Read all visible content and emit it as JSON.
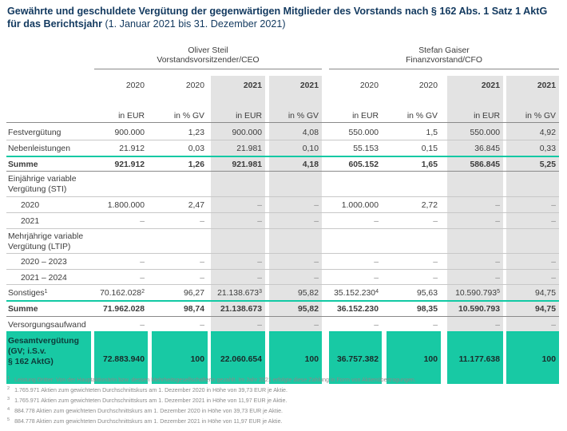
{
  "title": {
    "bold": "Gewährte und geschuldete Vergütung der gegenwärtigen Mitglieder des Vorstands nach § 162 Abs. 1 Satz 1 AktG für das Berichtsjahr",
    "light": "(1. Januar 2021 bis 31. Dezember 2021)"
  },
  "persons": [
    {
      "name": "Oliver Steil",
      "role": "Vorstandsvorsitzender/CEO"
    },
    {
      "name": "Stefan Gaiser",
      "role": "Finanzvorstand/CFO"
    }
  ],
  "years": [
    "2020",
    "2020",
    "2021",
    "2021",
    "2020",
    "2020",
    "2021",
    "2021"
  ],
  "units": [
    "in EUR",
    "in % GV",
    "in EUR",
    "in % GV",
    "in EUR",
    "in % GV",
    "in EUR",
    "in % GV"
  ],
  "rows": [
    {
      "label": "Festvergütung",
      "values": [
        "900.000",
        "1,23",
        "900.000",
        "4,08",
        "550.000",
        "1,5",
        "550.000",
        "4,92"
      ]
    },
    {
      "label": "Nebenleistungen",
      "values": [
        "21.912",
        "0,03",
        "21.981",
        "0,10",
        "55.153",
        "0,15",
        "36.845",
        "0,33"
      ]
    },
    {
      "label": "Summe",
      "values": [
        "921.912",
        "1,26",
        "921.981",
        "4,18",
        "605.152",
        "1,65",
        "586.845",
        "5,25"
      ]
    },
    {
      "label": "Einjährige variable",
      "label2": "Vergütung (STI)",
      "values": [
        "",
        "",
        "",
        "",
        "",
        "",
        "",
        ""
      ]
    },
    {
      "label": "2020",
      "values": [
        "1.800.000",
        "2,47",
        "–",
        "–",
        "1.000.000",
        "2,72",
        "–",
        "–"
      ]
    },
    {
      "label": "2021",
      "values": [
        "–",
        "–",
        "–",
        "–",
        "–",
        "–",
        "–",
        "–"
      ]
    },
    {
      "label": "Mehrjährige variable",
      "label2": "Vergütung (LTIP)",
      "values": [
        "",
        "",
        "",
        "",
        "",
        "",
        "",
        ""
      ]
    },
    {
      "label": "2020 – 2023",
      "values": [
        "–",
        "–",
        "–",
        "–",
        "–",
        "–",
        "–",
        "–"
      ]
    },
    {
      "label": "2021 – 2024",
      "values": [
        "–",
        "–",
        "–",
        "–",
        "–",
        "–",
        "–",
        "–"
      ]
    },
    {
      "label": "Sonstiges",
      "label_sup": "1",
      "values": [
        "70.162.028",
        "96,27",
        "21.138.673",
        "95,82",
        "35.152.230",
        "95,63",
        "10.590.793",
        "94,75"
      ],
      "sups": [
        "2",
        "",
        "3",
        "",
        "4",
        "",
        "5",
        ""
      ]
    },
    {
      "label": "Summe",
      "values": [
        "71.962.028",
        "98,74",
        "21.138.673",
        "95,82",
        "36.152.230",
        "98,35",
        "10.590.793",
        "94,75"
      ]
    },
    {
      "label": "Versorgungsaufwand",
      "values": [
        "–",
        "–",
        "–",
        "–",
        "–",
        "–",
        "–",
        "–"
      ]
    },
    {
      "label": "Gesamtvergütung",
      "label2": "(GV; i.S.v.",
      "label3": "§ 162 AktG)",
      "values": [
        "72.883.940",
        "100",
        "22.060.654",
        "100",
        "36.757.382",
        "100",
        "11.177.638",
        "100"
      ]
    }
  ],
  "footnotes": [
    {
      "n": "1",
      "text": "Leistung Dritter: Von der Hauptaktionärin bzw. dessen Mehrheitsgesellschafterin gezahlt. Im Jahr 2021 erfolgte diese Zahlung in Form von Aktienübertragungen."
    },
    {
      "n": "2",
      "text": "1.765.971 Aktien zum gewichteten Durchschnittskurs am 1. Dezember 2020 in Höhe von 39,73 EUR je Aktie."
    },
    {
      "n": "3",
      "text": "1.765.971 Aktien zum gewichteten Durchschnittskurs am 1. Dezember 2021 in Höhe von 11,97 EUR je Aktie."
    },
    {
      "n": "4",
      "text": "884.778 Aktien zum gewichteten Durchschnittskurs am 1. Dezember 2020 in Höhe von 39,73 EUR je Aktie."
    },
    {
      "n": "5",
      "text": "884.778 Aktien zum gewichteten Durchschnittskurs am 1. Dezember 2021 in Höhe von 11,97 EUR je Aktie."
    }
  ],
  "colors": {
    "title": "#12395f",
    "teal": "#18c9a4",
    "shade": "#e3e3e3"
  }
}
